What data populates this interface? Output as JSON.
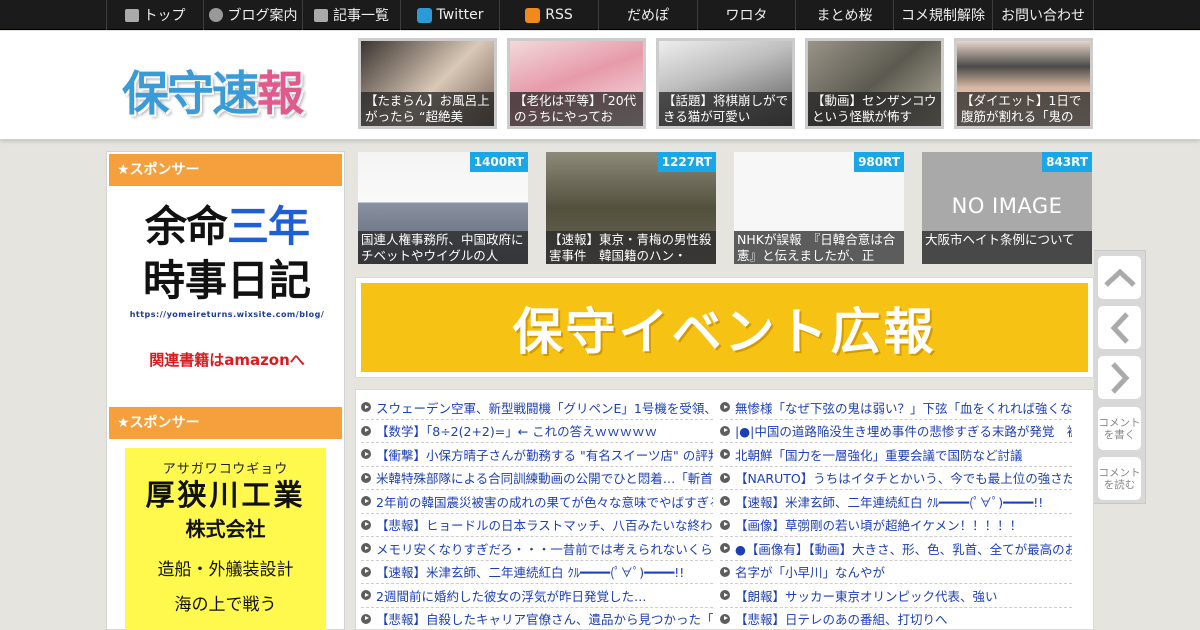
{
  "topnav": {
    "items": [
      {
        "label": "トップ",
        "icon": "home-icon"
      },
      {
        "label": "ブログ案内",
        "icon": "info-icon"
      },
      {
        "label": "記事一覧",
        "icon": "list-icon"
      },
      {
        "label": "Twitter",
        "icon": "twitter-icon"
      },
      {
        "label": "RSS",
        "icon": "rss-icon"
      },
      {
        "label": "だめぽ"
      },
      {
        "label": "ワロタ"
      },
      {
        "label": "まとめ桜"
      },
      {
        "label": "コメ規制解除"
      },
      {
        "label": "お問い合わせ"
      }
    ]
  },
  "header": {
    "logo_part1": "保守速",
    "logo_part2": "報",
    "thumbs": [
      {
        "caption": "【たまらん】お風呂上がったら “超絶美"
      },
      {
        "caption": "【老化は平等】「20代のうちにやってお"
      },
      {
        "caption": "【話題】将棋崩しができる猫が可愛い"
      },
      {
        "caption": "【動画】センザンコウという怪獣が怖す"
      },
      {
        "caption": "【ダイエット】1日で腹筋が割れる「鬼の"
      }
    ]
  },
  "sidebar": {
    "sponsor_label_1": "★スポンサー",
    "sponsor_label_2": "★スポンサー",
    "ad1": {
      "line1_a": "余命",
      "line1_b": "三年",
      "line2": "時事日記",
      "url": "https://yomeireturns.wixsite.com/blog/",
      "amazon": "関連書籍はamazonへ"
    },
    "ad2": {
      "kana": "アサガワコウギョウ",
      "name": "厚狭川工業",
      "suffix": "株式会社",
      "desc": "造船・外艤装設計",
      "tail": "海の上で戦う"
    }
  },
  "ranking": [
    {
      "rt": "1400RT",
      "caption": "国連人権事務所、中国政府にチベットやウイグルの人"
    },
    {
      "rt": "1227RT",
      "caption": "【速報】東京・青梅の男性殺害事件　韓国籍のハン・"
    },
    {
      "rt": "980RT",
      "caption": "NHKが誤報　『日韓合意は合憲』と伝えましたが、正"
    },
    {
      "rt": "843RT",
      "caption": "大阪市ヘイト条例について",
      "noimage": "NO IMAGE"
    }
  ],
  "banner": {
    "text": "保守イベント広報"
  },
  "links": {
    "left": [
      "スウェーデン空軍、新型戦闘機「グリペンE」1号機を受領、イ",
      "【数学】「8÷2(2+2)=」← これの答えｗｗｗｗｗ",
      "【衝撃】小保方晴子さんが勤務する \"有名スイーツ店\" の評判w",
      "米韓特殊部隊による合同訓練動画の公開でひと悶着…「斬首作",
      "2年前の韓国震災被害の成れの果てが色々な意味でやばすぎる",
      "【悲報】ヒョードルの日本ラストマッチ、八百みたいな終わり",
      "メモリ安くなりすぎだろ・・・一昔前では考えられないくらい",
      "【速報】米津玄師、二年連続紅白 ｸﾙ━━━━(ﾟ∀ﾟ)━━━━!!",
      "2週間前に婚約した彼女の浮気が昨日発覚した…",
      "【悲報】自殺したキャリア官僚さん、遺品から見つかった「残"
    ],
    "right": [
      "無惨様「なぜ下弦の鬼は弱い？」下弦「血をくれれば強くなれ",
      "|●|中国の道路陥没生き埋め事件の悲惨すぎる末路が発覚　被害",
      "北朝鮮「国力を一層強化」重要会議で国防など討議",
      "【NARUTO】うちはイタチとかいう、今でも最上位の強さだと",
      "【速報】米津玄師、二年連続紅白 ｸﾙ━━━━(ﾟ∀ﾟ)━━━━!!",
      "【画像】草彅剛の若い頃が超絶イケメン！！！！！",
      "●【画像有】【動画】大きさ、形、色、乳首、全てが最高のお●",
      "名字が「小早川」なんやが",
      "【朗報】サッカー東京オリンピック代表、強い",
      "【悲報】日テレのあの番組、打切りへ"
    ]
  },
  "side_controls": {
    "write_comment": "コメントを書く",
    "read_comment": "コメントを読む"
  }
}
